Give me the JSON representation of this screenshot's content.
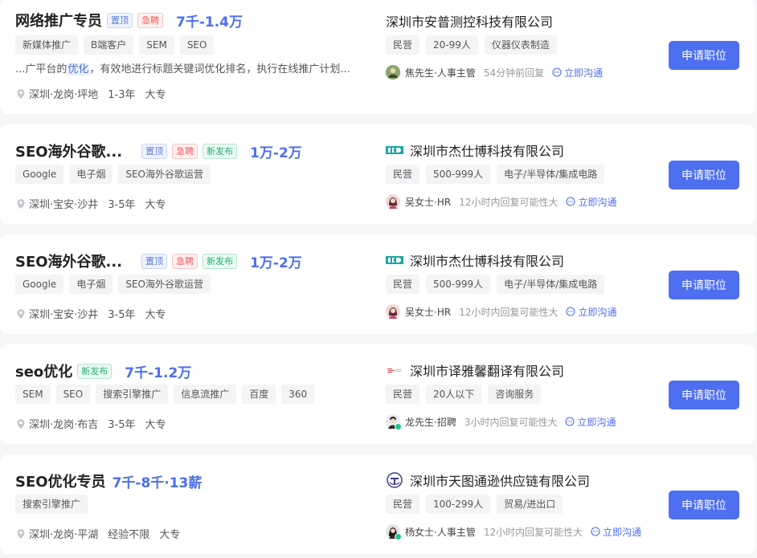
{
  "apply_label": "申请职位",
  "jobs": [
    {
      "title": "网络推广专员",
      "badges": [
        "置顶",
        "急聘"
      ],
      "salary": "7千-1.4万",
      "skills": [
        "新媒体推广",
        "B端客户",
        "SEM",
        "SEO"
      ],
      "desc_prefix": "...广平台的",
      "desc_highlight": "优化",
      "desc_suffix": "，有效地进行标题关键词优化排名，执行在线推广计划...",
      "location": "深圳·龙岗·坪地",
      "experience": "1-3年",
      "education": "大专",
      "company": "深圳市安普测控科技有限公司",
      "company_tags": [
        "民营",
        "20-99人",
        "仪器仪表制造"
      ],
      "recruiter": "焦先生·人事主管",
      "reply": "54分钟前回复",
      "chat": "立即沟通"
    },
    {
      "title": "SEO海外谷歌...",
      "badges": [
        "置顶",
        "急聘",
        "新发布"
      ],
      "salary": "1万-2万",
      "skills": [
        "Google",
        "电子烟",
        "SEO海外谷歌运营"
      ],
      "location": "深圳·宝安·沙井",
      "experience": "3-5年",
      "education": "大专",
      "company": "深圳市杰仕博科技有限公司",
      "company_tags": [
        "民营",
        "500-999人",
        "电子/半导体/集成电路"
      ],
      "recruiter": "吴女士·HR",
      "reply": "12小时内回复可能性大",
      "chat": "立即沟通"
    },
    {
      "title": "SEO海外谷歌...",
      "badges": [
        "置顶",
        "急聘",
        "新发布"
      ],
      "salary": "1万-2万",
      "skills": [
        "Google",
        "电子烟",
        "SEO海外谷歌运营"
      ],
      "location": "深圳·宝安·沙井",
      "experience": "3-5年",
      "education": "大专",
      "company": "深圳市杰仕博科技有限公司",
      "company_tags": [
        "民营",
        "500-999人",
        "电子/半导体/集成电路"
      ],
      "recruiter": "吴女士·HR",
      "reply": "12小时内回复可能性大",
      "chat": "立即沟通"
    },
    {
      "title": "seo优化",
      "badges": [
        "新发布"
      ],
      "salary": "7千-1.2万",
      "skills": [
        "SEM",
        "SEO",
        "搜索引擎推广",
        "信息流推广",
        "百度",
        "360"
      ],
      "location": "深圳·龙岗·布吉",
      "experience": "3-5年",
      "education": "大专",
      "company": "深圳市译雅馨翻译有限公司",
      "company_tags": [
        "民营",
        "20人以下",
        "咨询服务"
      ],
      "recruiter": "龙先生·招聘",
      "reply": "3小时内回复可能性大",
      "chat": "立即沟通"
    },
    {
      "title": "SEO优化专员",
      "badges": [],
      "salary": "7千-8千·13薪",
      "skills": [
        "搜索引擎推广"
      ],
      "location": "深圳·龙岗·平湖",
      "experience": "经验不限",
      "education": "大专",
      "company": "深圳市天图通逊供应链有限公司",
      "company_tags": [
        "民营",
        "100-299人",
        "贸易/进出口"
      ],
      "recruiter": "杨女士·人事主管",
      "reply": "12小时内回复可能性大",
      "chat": "立即沟通"
    }
  ]
}
